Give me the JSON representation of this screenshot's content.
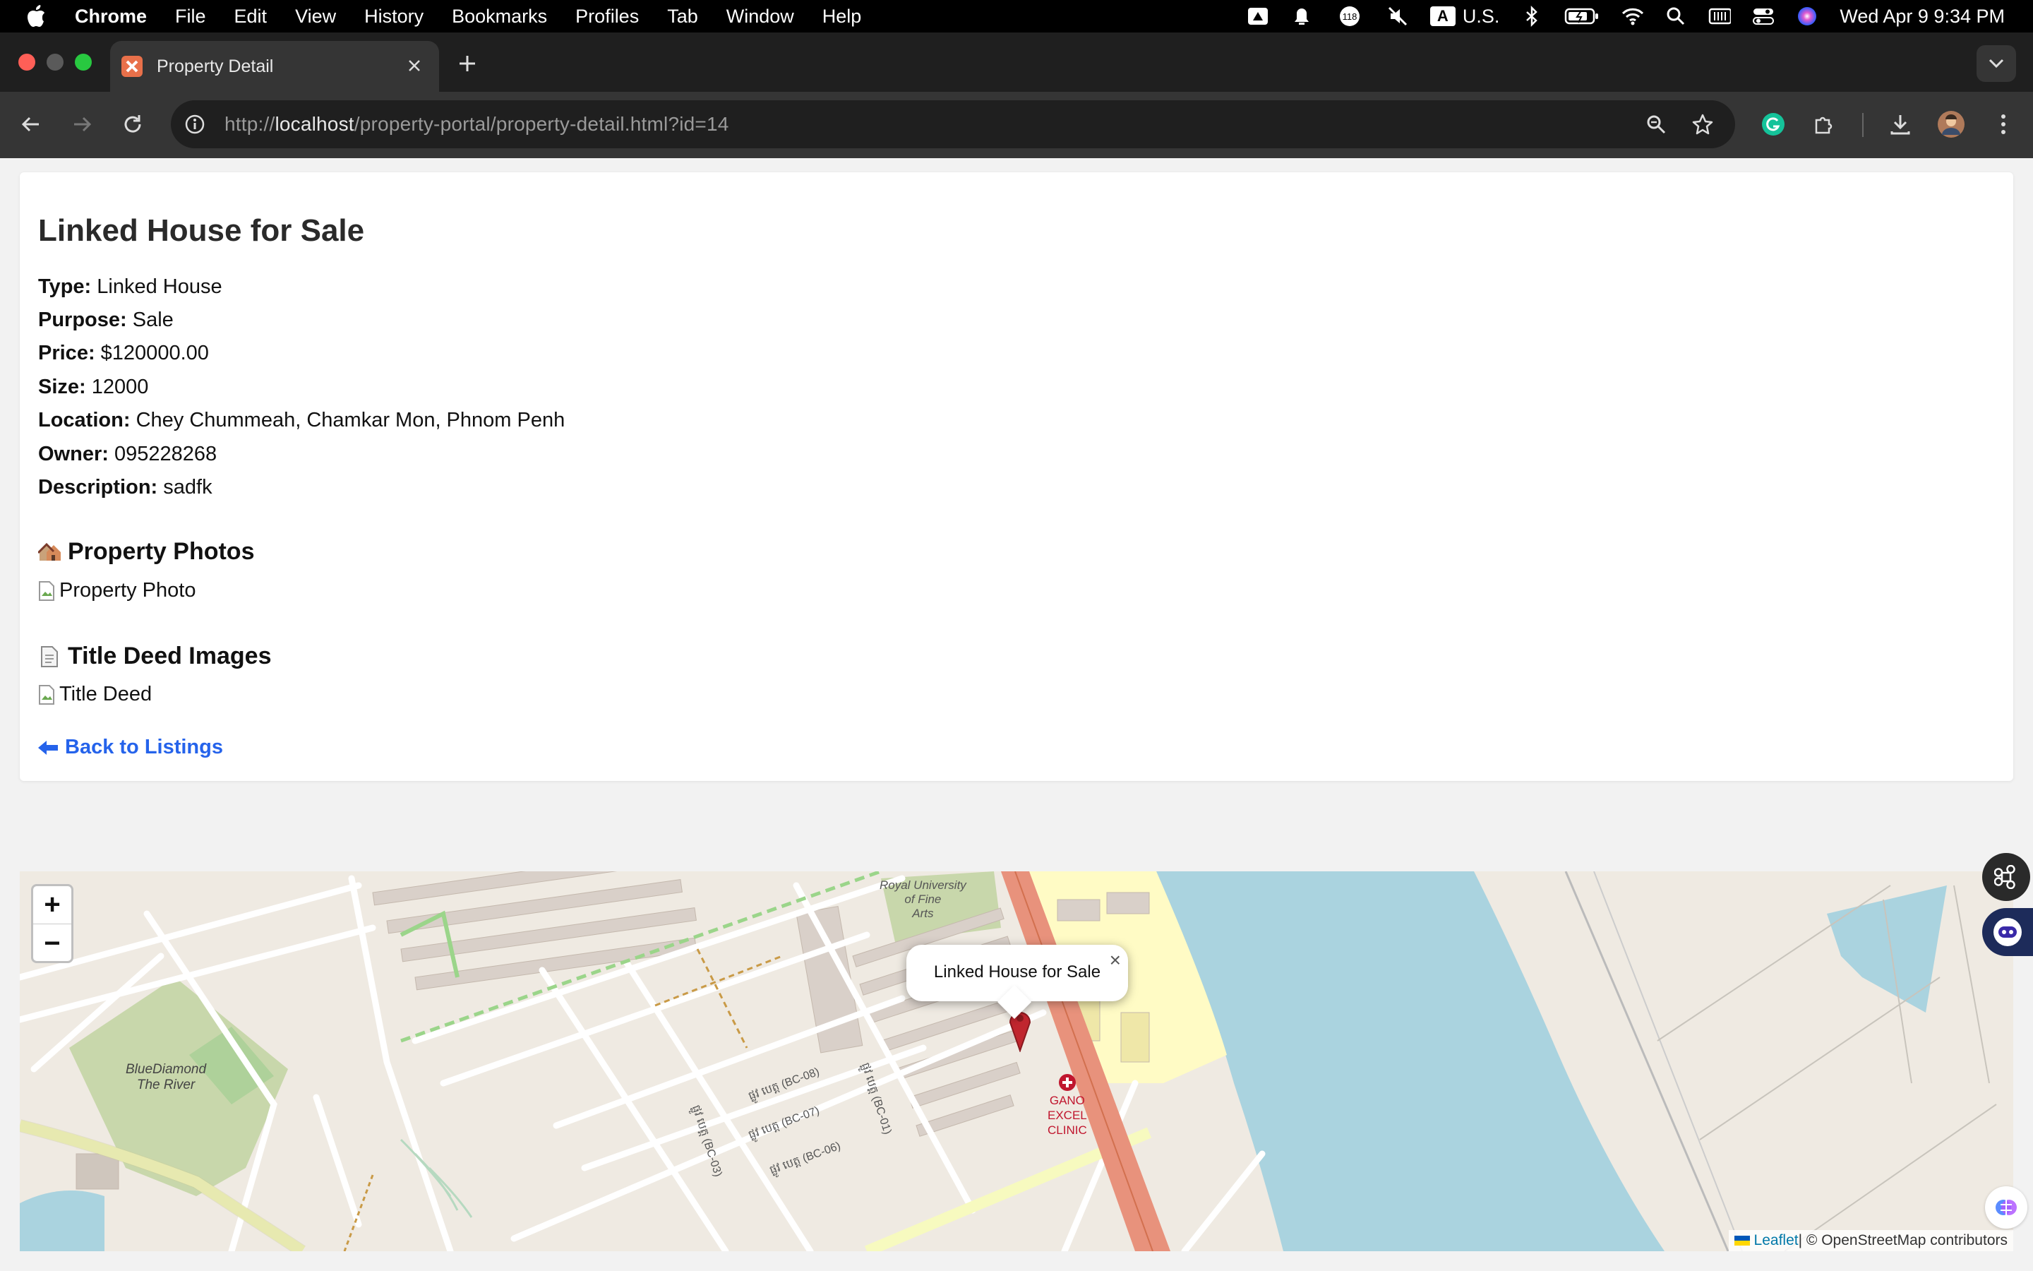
{
  "menubar": {
    "app": "Chrome",
    "items": [
      "File",
      "Edit",
      "View",
      "History",
      "Bookmarks",
      "Profiles",
      "Tab",
      "Window",
      "Help"
    ],
    "badge_count": "118",
    "input_source_letter": "A",
    "input_source": "U.S.",
    "clock": "Wed Apr 9  9:34 PM"
  },
  "tab": {
    "title": "Property Detail"
  },
  "omnibox": {
    "scheme": "http://",
    "host": "localhost",
    "path": "/property-portal/property-detail.html?id=14"
  },
  "property": {
    "title": "Linked House for Sale",
    "fields": [
      {
        "label": "Type:",
        "value": "Linked House"
      },
      {
        "label": "Purpose:",
        "value": "Sale"
      },
      {
        "label": "Price:",
        "value": "$120000.00"
      },
      {
        "label": "Size:",
        "value": "12000"
      },
      {
        "label": "Location:",
        "value": "Chey Chummeah, Chamkar Mon, Phnom Penh"
      },
      {
        "label": "Owner:",
        "value": "095228268"
      },
      {
        "label": "Description:",
        "value": "sadfk"
      }
    ],
    "photos_heading": "Property Photos",
    "photo_alt": "Property Photo",
    "deed_heading": "Title Deed Images",
    "deed_alt": "Title Deed",
    "back_link": "Back to Listings"
  },
  "map": {
    "zoom_in": "+",
    "zoom_out": "−",
    "popup_text": "Linked House for Sale",
    "popup_close": "×",
    "attribution_leaflet": "Leaflet",
    "attribution_rest": " | © OpenStreetMap contributors",
    "labels": {
      "university": [
        "Royal University",
        "of Fine",
        "Arts"
      ],
      "clinic": [
        "GANO",
        "EXCEL",
        "CLINIC"
      ],
      "bluediamond": [
        "BlueDiamond",
        "The River"
      ],
      "street1": "ផ្លូវ បេត្ត (BC-08)",
      "street2": "ផ្លូវ បេត្ត (BC-07)",
      "street3": "ផ្លូវ បេត្ត (BC-06)",
      "street4": "ផ្លូវ បេត្ត (BC-03)",
      "street5": "ផ្លូវ បេត្ត (BC-01)"
    }
  },
  "colors": {
    "accent_link": "#2563eb",
    "road_main": "#e8927c",
    "water": "#aad3df",
    "park": "#c8d7ab"
  }
}
